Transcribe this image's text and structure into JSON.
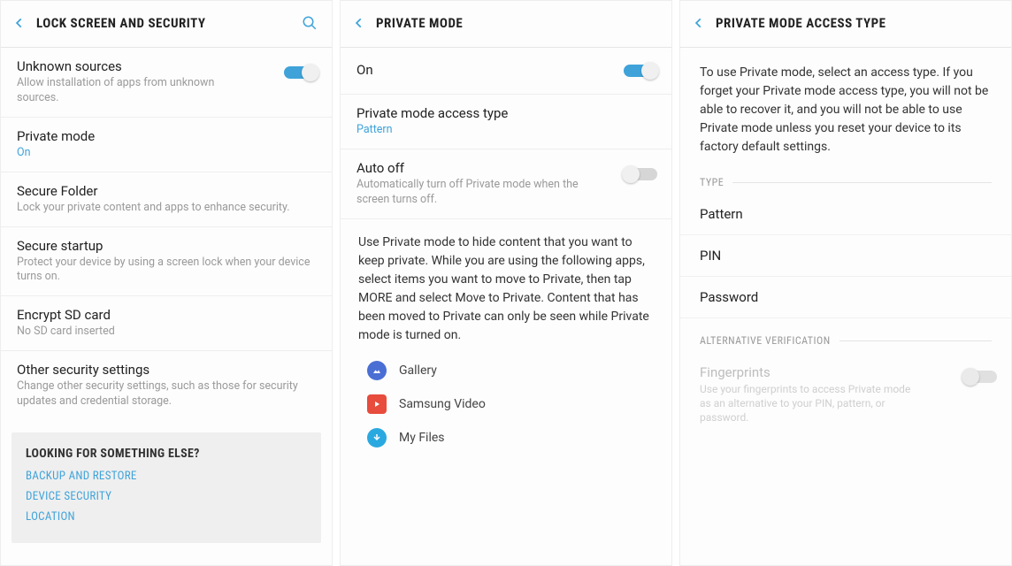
{
  "panel1": {
    "headerTitle": "LOCK SCREEN AND SECURITY",
    "items": {
      "unknownSources": {
        "title": "Unknown sources",
        "sub": "Allow installation of apps from unknown sources.",
        "on": true
      },
      "privateMode": {
        "title": "Private mode",
        "sub": "On"
      },
      "secureFolder": {
        "title": "Secure Folder",
        "sub": "Lock your private content and apps to enhance security."
      },
      "secureStartup": {
        "title": "Secure startup",
        "sub": "Protect your device by using a screen lock when your device turns on."
      },
      "encryptSd": {
        "title": "Encrypt SD card",
        "sub": "No SD card inserted"
      },
      "otherSecurity": {
        "title": "Other security settings",
        "sub": "Change other security settings, such as those for security updates and credential storage."
      }
    },
    "suggest": {
      "title": "LOOKING FOR SOMETHING ELSE?",
      "links": [
        "BACKUP AND RESTORE",
        "DEVICE SECURITY",
        "LOCATION"
      ]
    }
  },
  "panel2": {
    "headerTitle": "PRIVATE MODE",
    "items": {
      "onToggle": {
        "title": "On",
        "on": true
      },
      "accessType": {
        "title": "Private mode access type",
        "sub": "Pattern"
      },
      "autoOff": {
        "title": "Auto off",
        "sub": "Automatically turn off Private mode when the screen turns off.",
        "on": false
      }
    },
    "description": "Use Private mode to hide content that you want to keep private. While you are using the follow­ing apps, select items you want to move to Pri­vate, then tap MORE and select Move to Private. Content that has been moved to Private can only be seen while Private mode is turned on.",
    "apps": [
      {
        "name": "Gallery",
        "iconClass": "blue",
        "iconKind": "gallery-icon"
      },
      {
        "name": "Samsung Video",
        "iconClass": "red",
        "iconKind": "video-icon"
      },
      {
        "name": "My Files",
        "iconClass": "cyan",
        "iconKind": "files-icon"
      }
    ]
  },
  "panel3": {
    "headerTitle": "PRIVATE MODE ACCESS TYPE",
    "intro": "To use Private mode, select an access type. If you forget your Private mode access type, you will not be able to recover it, and you will not be able to use Private mode unless you reset your device to its factory default settings.",
    "typeLabel": "TYPE",
    "types": [
      "Pattern",
      "PIN",
      "Password"
    ],
    "altLabel": "ALTERNATIVE VERIFICATION",
    "fingerprints": {
      "title": "Fingerprints",
      "sub": "Use your fingerprints to access Private mode as an alternative to your PIN, pattern, or password.",
      "on": false
    }
  }
}
